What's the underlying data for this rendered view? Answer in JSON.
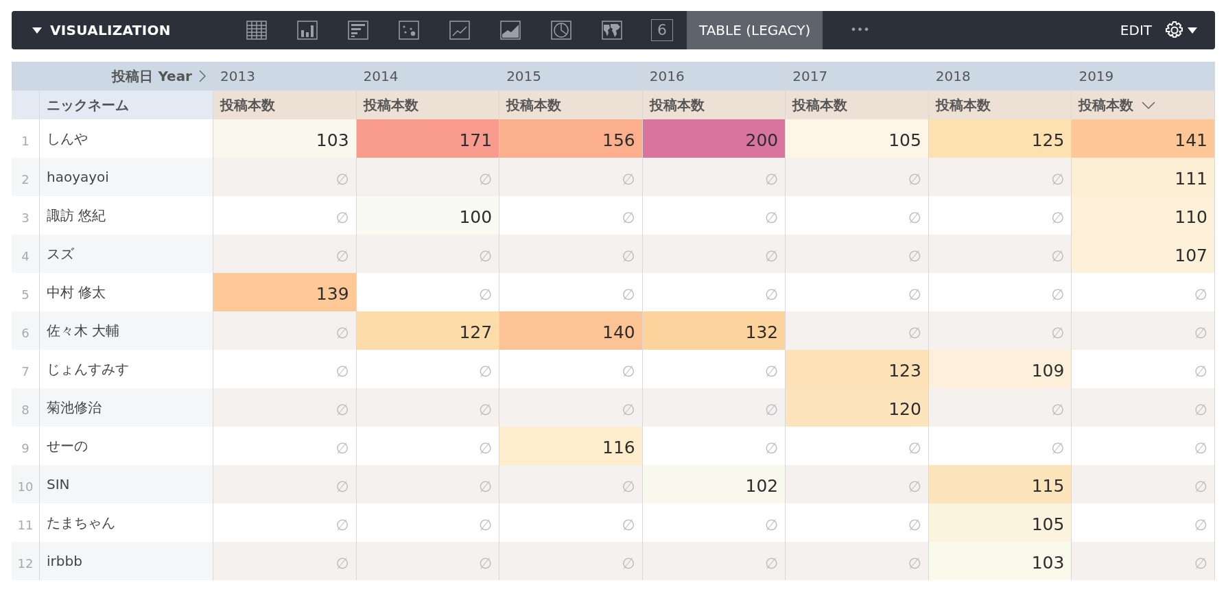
{
  "toolbar": {
    "title": "VISUALIZATION",
    "expanded": true,
    "tabs": [
      {
        "kind": "table",
        "selected": false
      },
      {
        "kind": "bar",
        "selected": false
      },
      {
        "kind": "hbar",
        "selected": false
      },
      {
        "kind": "scatter",
        "selected": false
      },
      {
        "kind": "line",
        "selected": false
      },
      {
        "kind": "area",
        "selected": false
      },
      {
        "kind": "pie",
        "selected": false
      },
      {
        "kind": "map",
        "selected": false
      },
      {
        "kind": "number",
        "label": "6",
        "selected": false
      },
      {
        "kind": "text",
        "label": "TABLE (LEGACY)",
        "selected": true
      },
      {
        "kind": "more",
        "label": "•••",
        "selected": false
      }
    ],
    "edit": "EDIT"
  },
  "table": {
    "pivot_label": "投稿日 Year",
    "dimension": "ニックネーム",
    "columns": [
      {
        "year": "2013",
        "measure": "投稿本数",
        "sorted": false
      },
      {
        "year": "2014",
        "measure": "投稿本数",
        "sorted": false
      },
      {
        "year": "2015",
        "measure": "投稿本数",
        "sorted": false
      },
      {
        "year": "2016",
        "measure": "投稿本数",
        "sorted": false
      },
      {
        "year": "2017",
        "measure": "投稿本数",
        "sorted": false
      },
      {
        "year": "2018",
        "measure": "投稿本数",
        "sorted": false
      },
      {
        "year": "2019",
        "measure": "投稿本数",
        "sorted": true
      }
    ],
    "rows": [
      {
        "index": "1",
        "name": "しんや",
        "cells": [
          {
            "value": "103",
            "color": "#faf7ec"
          },
          {
            "value": "171",
            "color": "#f89a8c"
          },
          {
            "value": "156",
            "color": "#fbaf8c"
          },
          {
            "value": "200",
            "color": "#d9749f"
          },
          {
            "value": "105",
            "color": "#fdf5e6"
          },
          {
            "value": "125",
            "color": "#fde1b1"
          },
          {
            "value": "141",
            "color": "#fec797"
          }
        ]
      },
      {
        "index": "2",
        "name": "haoyayoi",
        "cells": [
          {
            "value": "∅"
          },
          {
            "value": "∅"
          },
          {
            "value": "∅"
          },
          {
            "value": "∅"
          },
          {
            "value": "∅"
          },
          {
            "value": "∅"
          },
          {
            "value": "111",
            "color": "#fdefd6"
          }
        ]
      },
      {
        "index": "3",
        "name": "諏訪 悠紀",
        "cells": [
          {
            "value": "∅"
          },
          {
            "value": "100",
            "color": "#f9faf1"
          },
          {
            "value": "∅"
          },
          {
            "value": "∅"
          },
          {
            "value": "∅"
          },
          {
            "value": "∅"
          },
          {
            "value": "110",
            "color": "#fdf0d8"
          }
        ]
      },
      {
        "index": "4",
        "name": "スズ",
        "cells": [
          {
            "value": "∅"
          },
          {
            "value": "∅"
          },
          {
            "value": "∅"
          },
          {
            "value": "∅"
          },
          {
            "value": "∅"
          },
          {
            "value": "∅"
          },
          {
            "value": "107",
            "color": "#fdf1da"
          }
        ]
      },
      {
        "index": "5",
        "name": "中村 修太",
        "cells": [
          {
            "value": "139",
            "color": "#fec997"
          },
          {
            "value": "∅"
          },
          {
            "value": "∅"
          },
          {
            "value": "∅"
          },
          {
            "value": "∅"
          },
          {
            "value": "∅"
          },
          {
            "value": "∅"
          }
        ]
      },
      {
        "index": "6",
        "name": "佐々木 大輔",
        "cells": [
          {
            "value": "∅"
          },
          {
            "value": "127",
            "color": "#fddcaa"
          },
          {
            "value": "140",
            "color": "#fcc495"
          },
          {
            "value": "132",
            "color": "#fdd49e"
          },
          {
            "value": "∅"
          },
          {
            "value": "∅"
          },
          {
            "value": "∅"
          }
        ]
      },
      {
        "index": "7",
        "name": "じょんすみす",
        "cells": [
          {
            "value": "∅"
          },
          {
            "value": "∅"
          },
          {
            "value": "∅"
          },
          {
            "value": "∅"
          },
          {
            "value": "123",
            "color": "#fde2b8"
          },
          {
            "value": "109",
            "color": "#fdf0db"
          },
          {
            "value": "∅"
          }
        ]
      },
      {
        "index": "8",
        "name": "菊池修治",
        "cells": [
          {
            "value": "∅"
          },
          {
            "value": "∅"
          },
          {
            "value": "∅"
          },
          {
            "value": "∅"
          },
          {
            "value": "120",
            "color": "#fde4bd"
          },
          {
            "value": "∅"
          },
          {
            "value": "∅"
          }
        ]
      },
      {
        "index": "9",
        "name": "せーの",
        "cells": [
          {
            "value": "∅"
          },
          {
            "value": "∅"
          },
          {
            "value": "116",
            "color": "#fdedcd"
          },
          {
            "value": "∅"
          },
          {
            "value": "∅"
          },
          {
            "value": "∅"
          },
          {
            "value": "∅"
          }
        ]
      },
      {
        "index": "10",
        "name": "SIN",
        "cells": [
          {
            "value": "∅"
          },
          {
            "value": "∅"
          },
          {
            "value": "∅"
          },
          {
            "value": "102",
            "color": "#f8f9ec"
          },
          {
            "value": "∅"
          },
          {
            "value": "115",
            "color": "#fde5bb"
          },
          {
            "value": "∅"
          }
        ]
      },
      {
        "index": "11",
        "name": "たまちゃん",
        "cells": [
          {
            "value": "∅"
          },
          {
            "value": "∅"
          },
          {
            "value": "∅"
          },
          {
            "value": "∅"
          },
          {
            "value": "∅"
          },
          {
            "value": "105",
            "color": "#fdf4e0"
          },
          {
            "value": "∅"
          }
        ]
      },
      {
        "index": "12",
        "name": "irbbb",
        "cells": [
          {
            "value": "∅"
          },
          {
            "value": "∅"
          },
          {
            "value": "∅"
          },
          {
            "value": "∅"
          },
          {
            "value": "∅"
          },
          {
            "value": "103",
            "color": "#f9f9ec"
          },
          {
            "value": "∅"
          }
        ]
      }
    ]
  }
}
